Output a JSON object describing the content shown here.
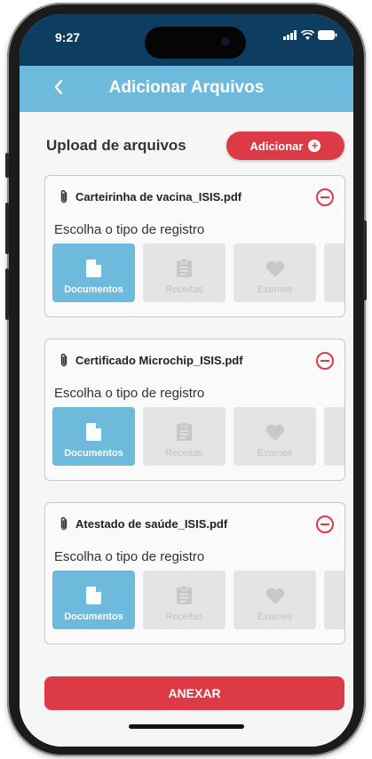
{
  "status_bar": {
    "time": "9:27"
  },
  "header": {
    "title": "Adicionar Arquivos",
    "back_icon": "chevron-left-icon"
  },
  "upload": {
    "title": "Upload de arquivos",
    "add_label": "Adicionar"
  },
  "files": [
    {
      "name": "Carteirinha de vacina_ISIS.pdf",
      "choose_label": "Escolha o tipo de registro",
      "selected": "Documentos"
    },
    {
      "name": "Certificado Microchip_ISIS.pdf",
      "choose_label": "Escolha o tipo de registro",
      "selected": "Documentos"
    },
    {
      "name": "Atestado de saúde_ISIS.pdf",
      "choose_label": "Escolha o tipo de registro",
      "selected": "Documentos"
    }
  ],
  "record_types": [
    "Documentos",
    "Receitas",
    "Exames"
  ],
  "attach_label": "ANEXAR",
  "colors": {
    "accent_red": "#dc3a45",
    "header_blue": "#6dbadd",
    "status_navy": "#0d3d60"
  }
}
